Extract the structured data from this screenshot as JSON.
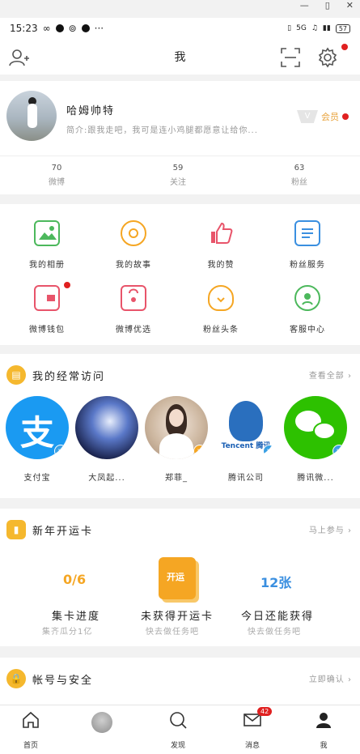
{
  "window": {
    "minimize": "—",
    "maximize": "▯",
    "close": "✕"
  },
  "status_bar": {
    "time": "15:23",
    "net": "5G",
    "battery": "57"
  },
  "header": {
    "title": "我"
  },
  "profile": {
    "username": "哈姆帅特",
    "bio": "简介:跟我走吧，我可是连小鸡腿都愿意让给你...",
    "member_label": "会员",
    "member_badge": "V",
    "stats": [
      {
        "count": "70",
        "label": "微博"
      },
      {
        "count": "59",
        "label": "关注"
      },
      {
        "count": "63",
        "label": "粉丝"
      }
    ]
  },
  "services": [
    {
      "label": "我的相册",
      "icon": "album-icon"
    },
    {
      "label": "我的故事",
      "icon": "story-icon"
    },
    {
      "label": "我的赞",
      "icon": "like-icon"
    },
    {
      "label": "粉丝服务",
      "icon": "fan-service-icon"
    },
    {
      "label": "微博钱包",
      "icon": "wallet-icon"
    },
    {
      "label": "微博优选",
      "icon": "shopping-bag-icon"
    },
    {
      "label": "粉丝头条",
      "icon": "lightbulb-icon"
    },
    {
      "label": "客服中心",
      "icon": "headset-icon"
    }
  ],
  "visits": {
    "title": "我的经常访问",
    "more": "查看全部",
    "items": [
      {
        "name": "支付宝",
        "logo_char": "支"
      },
      {
        "name": "大凤起..."
      },
      {
        "name": "郑菲_"
      },
      {
        "name": "腾讯公司",
        "logo_text": "Tencent 腾讯"
      },
      {
        "name": "腾讯微..."
      }
    ]
  },
  "new_year": {
    "title": "新年开运卡",
    "more": "马上参与",
    "progress_value": "0/6",
    "progress_title": "集卡进度",
    "progress_sub": "集齐瓜分1亿",
    "card_label": "开运",
    "unobtained_title": "未获得开运卡",
    "unobtained_sub": "快去做任务吧",
    "today_value": "12张",
    "today_title": "今日还能获得",
    "today_sub": "快去做任务吧"
  },
  "account": {
    "title": "帐号与安全",
    "more": "立即确认"
  },
  "tabbar": [
    {
      "label": "首页"
    },
    {
      "label": ""
    },
    {
      "label": "发现"
    },
    {
      "label": "消息",
      "badge": "42"
    },
    {
      "label": "我"
    }
  ],
  "colors": {
    "accent": "#f5b82e",
    "badge_red": "#e02020",
    "vip_blue": "#3aa0e4"
  }
}
